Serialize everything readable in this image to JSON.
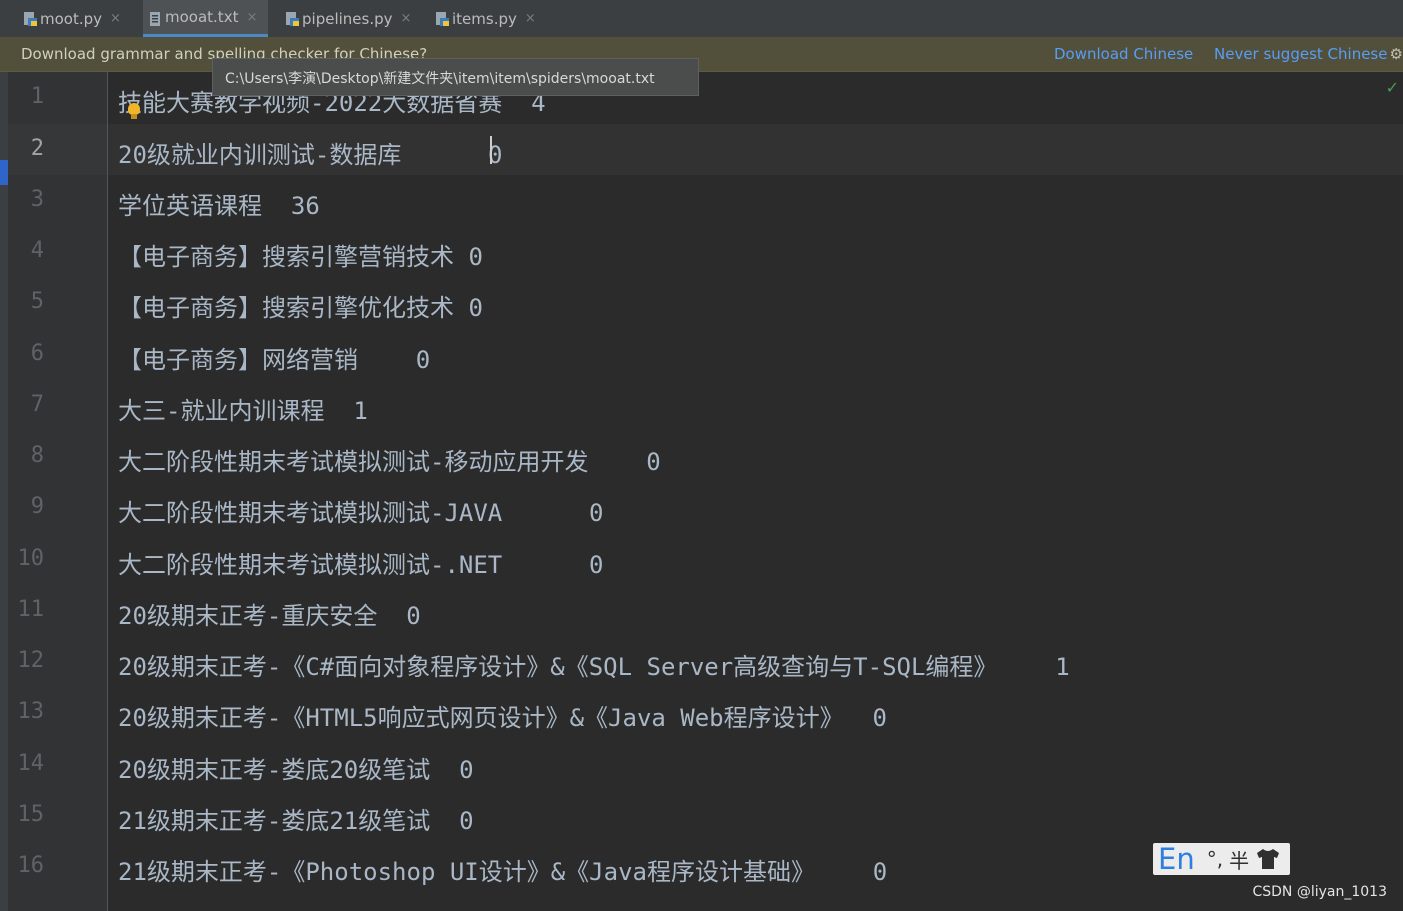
{
  "tabs": [
    {
      "label": "moot.py",
      "icon": "python-file-icon"
    },
    {
      "label": "mooat.txt",
      "icon": "text-file-icon",
      "active": true
    },
    {
      "label": "pipelines.py",
      "icon": "python-file-icon"
    },
    {
      "label": "items.py",
      "icon": "python-file-icon"
    }
  ],
  "close_glyph": "×",
  "notification": {
    "text": "Download grammar and spelling checker for Chinese?",
    "action_download": "Download Chinese",
    "action_never": "Never suggest Chinese",
    "gear_icon": "gear-icon"
  },
  "tooltip": {
    "path": "C:\\Users\\李演\\Desktop\\新建文件夹\\item\\item\\spiders\\mooat.txt"
  },
  "editor": {
    "current_line": 2,
    "line_numbers": [
      "1",
      "2",
      "3",
      "4",
      "5",
      "6",
      "7",
      "8",
      "9",
      "10",
      "11",
      "12",
      "13",
      "14",
      "15",
      "16"
    ],
    "lines": [
      "技能大赛教学视频-2022大数据省赛  4",
      "20级就业内训测试-数据库      0",
      "学位英语课程  36",
      "【电子商务】搜索引擎营销技术 0",
      "【电子商务】搜索引擎优化技术 0",
      "【电子商务】网络营销    0",
      "大三-就业内训课程  1",
      "大二阶段性期末考试模拟测试-移动应用开发    0",
      "大二阶段性期末考试模拟测试-JAVA      0",
      "大二阶段性期末考试模拟测试-.NET      0",
      "20级期末正考-重庆安全  0",
      "20级期末正考-《C#面向对象程序设计》&《SQL Server高级查询与T-SQL编程》    1",
      "20级期末正考-《HTML5响应式网页设计》&《Java Web程序设计》  0",
      "20级期末正考-娄底20级笔试  0",
      "21级期末正考-娄底21级笔试  0",
      "21级期末正考-《Photoshop UI设计》&《Java程序设计基础》    0"
    ]
  },
  "ime": {
    "mode": "En",
    "punct": "°,",
    "width": "半",
    "skin_icon": "shirt-icon"
  },
  "watermark": "CSDN @liyan_1013",
  "colors": {
    "accent": "#4a88c7",
    "link": "#589df6",
    "notification_bg": "#52503a",
    "editor_bg": "#2b2b2b"
  }
}
